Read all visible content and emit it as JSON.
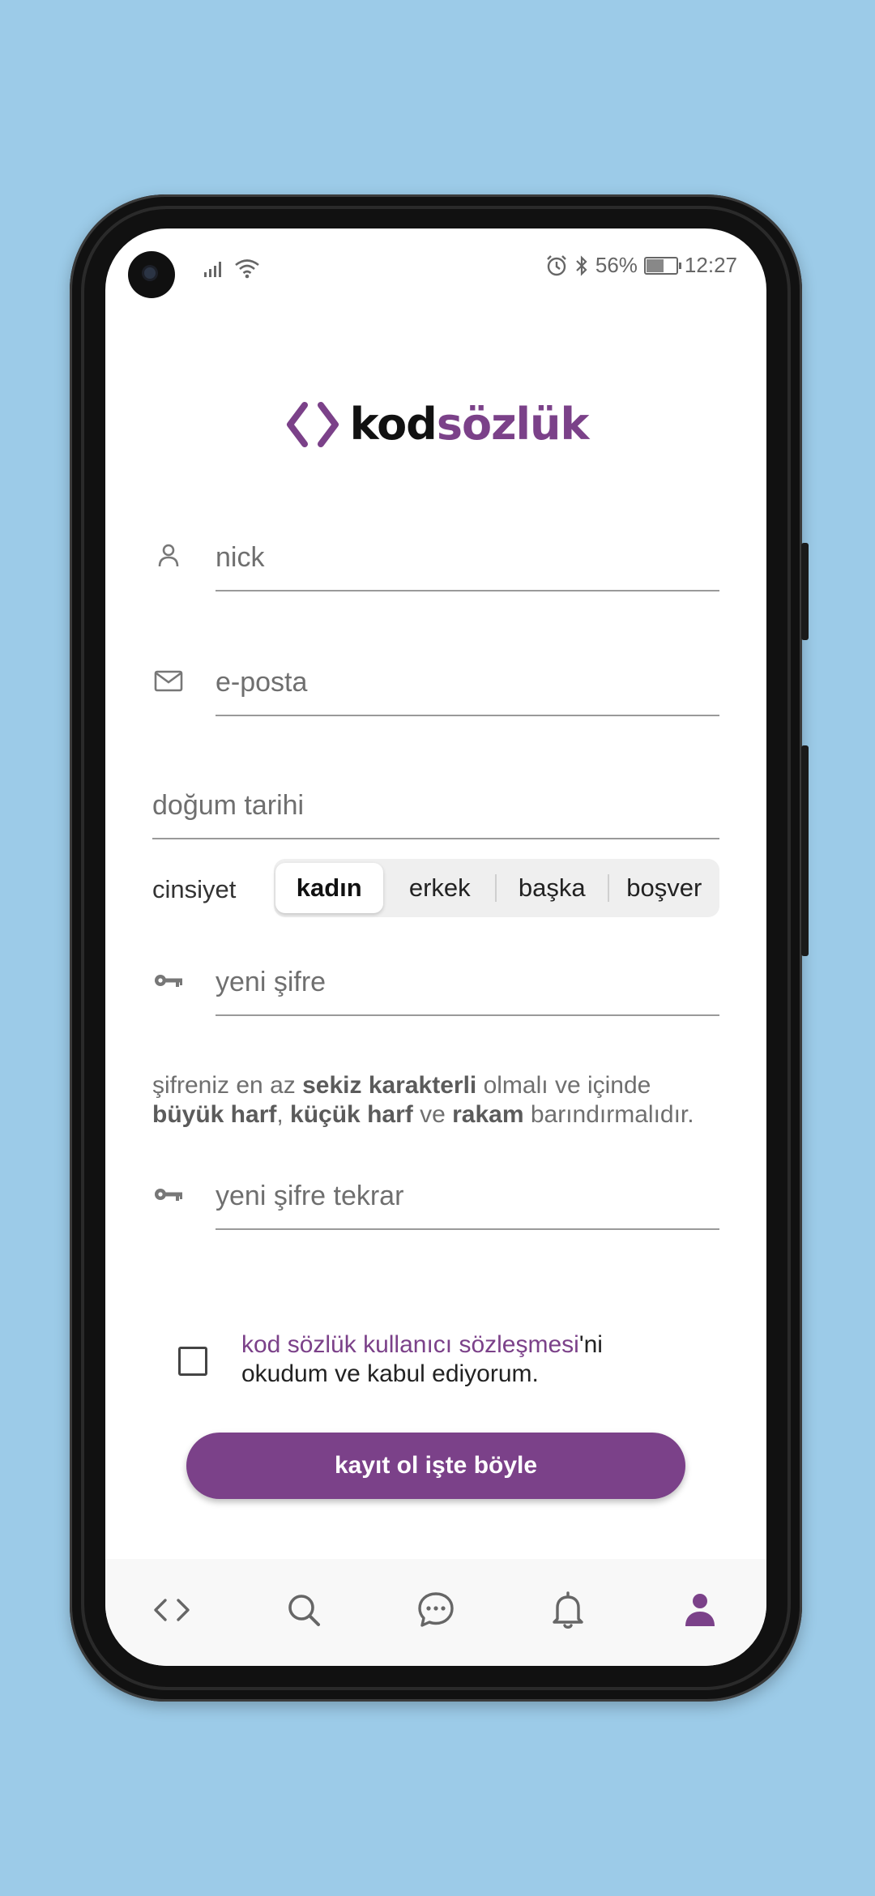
{
  "status_bar": {
    "battery_percent": "56%",
    "time": "12:27"
  },
  "logo": {
    "brackets": "< >",
    "kod": "kod",
    "sozluk": "sözlük"
  },
  "form": {
    "nick_placeholder": "nick",
    "email_placeholder": "e-posta",
    "birthdate_placeholder": "doğum tarihi",
    "gender_label": "cinsiyet",
    "gender_options": [
      "kadın",
      "erkek",
      "başka",
      "boşver"
    ],
    "gender_selected": "kadın",
    "password_placeholder": "yeni şifre",
    "password_hint": {
      "p1": "şifreniz en az ",
      "b1": "sekiz karakterli",
      "p2": " olmalı ve içinde",
      "b2": "büyük harf",
      "p3": ", ",
      "b3": "küçük harf",
      "p4": " ve ",
      "b4": "rakam",
      "p5": " barındırmalıdır."
    },
    "password_repeat_placeholder": "yeni şifre tekrar",
    "agreement": {
      "link_text": "kod sözlük kullanıcı sözleşmesi",
      "suffix": "'ni",
      "line2": "okudum ve kabul ediyorum.",
      "checked": false
    },
    "submit_label": "kayıt ol işte böyle"
  },
  "bottom_nav": {
    "items": [
      "code-icon",
      "search-icon",
      "chat-icon",
      "bell-icon",
      "profile-icon"
    ],
    "active": "profile-icon"
  },
  "colors": {
    "brand": "#7b4189",
    "background": "#9ccbe8"
  }
}
